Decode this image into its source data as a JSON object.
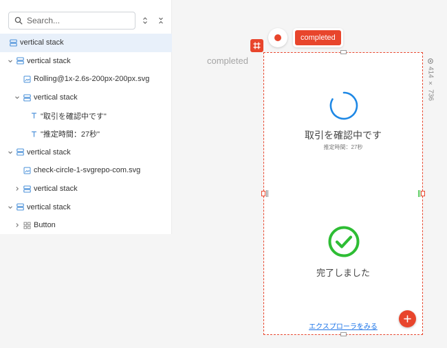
{
  "search": {
    "placeholder": "Search..."
  },
  "tree": [
    {
      "label": "vertical stack",
      "type": "stack",
      "depth": 0,
      "chevron": "none",
      "selected": true
    },
    {
      "label": "vertical stack",
      "type": "stack",
      "depth": 0,
      "chevron": "down"
    },
    {
      "label": "Rolling@1x-2.6s-200px-200px.svg",
      "type": "image",
      "depth": 1,
      "chevron": "none"
    },
    {
      "label": "vertical stack",
      "type": "stack",
      "depth": 1,
      "chevron": "down"
    },
    {
      "label": "\"取引を確認中です\"",
      "type": "text",
      "depth": 2,
      "chevron": "none"
    },
    {
      "label": "\"推定時間：27秒\"",
      "type": "text",
      "depth": 2,
      "chevron": "none"
    },
    {
      "label": "vertical stack",
      "type": "stack",
      "depth": 0,
      "chevron": "down"
    },
    {
      "label": "check-circle-1-svgrepo-com.svg",
      "type": "image",
      "depth": 1,
      "chevron": "none"
    },
    {
      "label": "vertical stack",
      "type": "stack",
      "depth": 1,
      "chevron": "right"
    },
    {
      "label": "vertical stack",
      "type": "stack",
      "depth": 0,
      "chevron": "down"
    },
    {
      "label": "Button",
      "type": "component",
      "depth": 1,
      "chevron": "right"
    }
  ],
  "canvas": {
    "frame_label": "completed",
    "state_badge": "completed",
    "size_label": "414 × 736"
  },
  "screen": {
    "title": "取引を確認中です",
    "subtitle": "推定時間：27秒",
    "done": "完了しました",
    "link": "エクスプローラをみる"
  },
  "colors": {
    "accent": "#e8452c",
    "spinner": "#1e88e5",
    "success": "#2ebd34",
    "link": "#1a73e8",
    "selected_row": "#e8f0fa"
  }
}
